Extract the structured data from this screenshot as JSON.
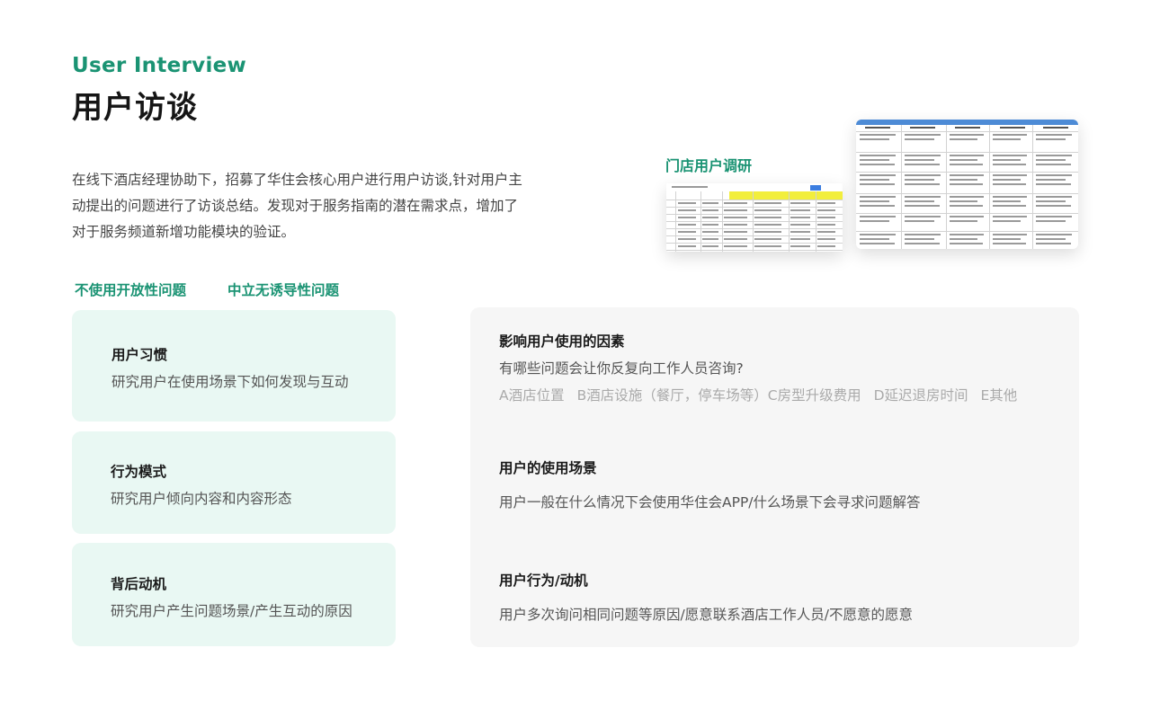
{
  "header": {
    "eyebrow": "User Interview",
    "title": "用户访谈"
  },
  "intro": {
    "text": "在线下酒店经理协助下，招募了华住会核心用户进行用户访谈,针对用户主动提出的问题进行了访谈总结。发现对于服务指南的潜在需求点，增加了对于服务频道新增功能模块的验证。"
  },
  "tags": [
    "不使用开放性问题",
    "中立无诱导性问题"
  ],
  "cards": [
    {
      "title": "用户习惯",
      "desc": "研究用户在使用场景下如何发现与互动"
    },
    {
      "title": "行为模式",
      "desc": "研究用户倾向内容和内容形态"
    },
    {
      "title": "背后动机",
      "desc": "研究用户产生问题场景/产生互动的原因"
    }
  ],
  "panel": {
    "factors": {
      "title": "影响用户使用的因素",
      "question": "有哪些问题会让你反复向工作人员咨询?",
      "options": [
        "A酒店位置",
        "B酒店设施（餐厅，停车场等）C房型升级费用",
        "D延迟退房时间",
        "E其他"
      ]
    },
    "scenario": {
      "title": "用户的使用场景",
      "desc": "用户一般在什么情况下会使用华住会APP/什么场景下会寻求问题解答"
    },
    "motivation": {
      "title": "用户行为/动机",
      "desc": "用户多次询问相同问题等原因/愿意联系酒店工作人员/不愿意的愿意"
    }
  },
  "research": {
    "label": "门店用户调研"
  }
}
